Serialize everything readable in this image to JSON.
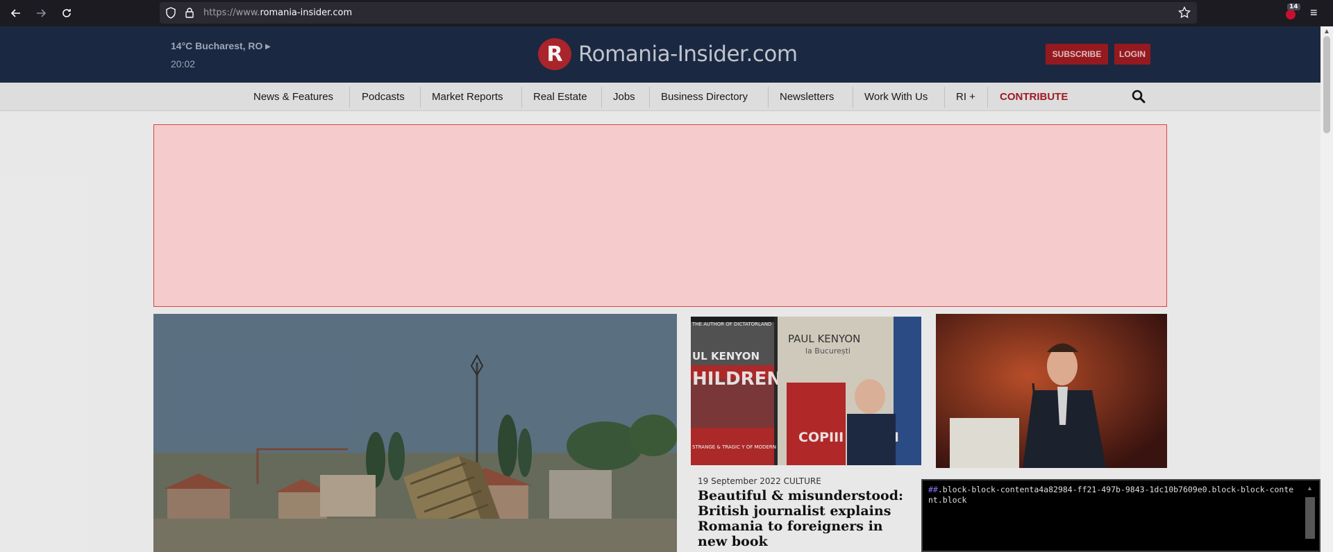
{
  "browser": {
    "url_prefix": "https://www.",
    "url_domain": "romania-insider.com",
    "extension_count": "14"
  },
  "header": {
    "weather": "14°C Bucharest, RO ▸",
    "time": "20:02",
    "logo_letter": "R",
    "logo_text": "Romania-Insider.com",
    "subscribe_label": "SUBSCRIBE",
    "login_label": "LOGIN"
  },
  "nav": {
    "items": [
      {
        "label": "News & Features"
      },
      {
        "label": "Podcasts"
      },
      {
        "label": "Market Reports"
      },
      {
        "label": "Real Estate"
      },
      {
        "label": "Jobs"
      },
      {
        "label": "Business Directory"
      },
      {
        "label": "Newsletters"
      },
      {
        "label": "Work With Us"
      },
      {
        "label": "RI +"
      },
      {
        "label": "CONTRIBUTE"
      }
    ]
  },
  "articles": {
    "featured": {
      "meta": "19 September 2022 CULTURE",
      "title": "Beautiful & misunderstood: British journalist explains Romania to foreigners in new book"
    },
    "book_image": {
      "top_text": "THE AUTHOR OF DICTATORLAND",
      "author_left": "UL KENYON",
      "title_left": "HILDREN F THE IGHT",
      "subtitle_left": "STRANGE & TRAGIC Y OF MODERN ROMANIA",
      "author_right": "PAUL KENYON",
      "location_right": "la București",
      "book_title_right": "COPIII NOPȚII"
    }
  },
  "filter_tooltip": {
    "hash": "##",
    "rule": ".block-block-contenta4a82984-ff21-497b-9843-1dc10b7609e0.block-block-content.block"
  },
  "colors": {
    "header_bg": "#1d2a44",
    "accent_red": "#a51c24",
    "ad_bg": "#ffd4d4"
  }
}
